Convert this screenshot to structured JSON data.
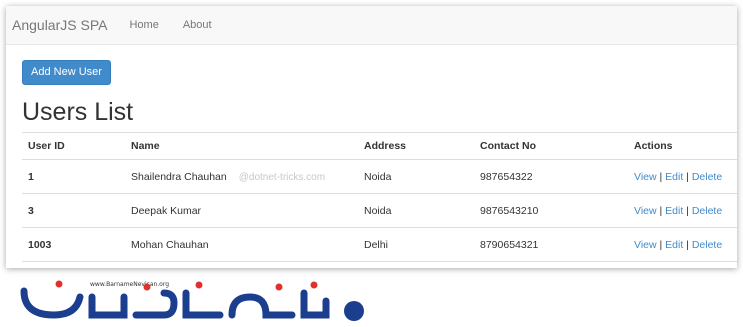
{
  "navbar": {
    "brand": "AngularJS SPA",
    "links": [
      "Home",
      "About"
    ]
  },
  "main": {
    "add_button": "Add New User",
    "title": "Users List"
  },
  "table": {
    "headers": [
      "User ID",
      "Name",
      "Address",
      "Contact No",
      "Actions"
    ],
    "rows": [
      {
        "id": "1",
        "name": "Shailendra Chauhan",
        "address": "Noida",
        "contact": "987654322"
      },
      {
        "id": "3",
        "name": "Deepak Kumar",
        "address": "Noida",
        "contact": "9876543210"
      },
      {
        "id": "1003",
        "name": "Mohan Chauhan",
        "address": "Delhi",
        "contact": "8790654321"
      }
    ],
    "actions": {
      "view": "View",
      "edit": "Edit",
      "delete": "Delete",
      "separator": "|"
    },
    "watermark": "@dotnet-tricks.com"
  },
  "logo": {
    "url_text": "www.BarnameNevisan.org",
    "colors": {
      "blue": "#1c3e8f",
      "red": "#e0312f"
    }
  },
  "colors": {
    "accent": "#428bca",
    "navbar_bg": "#f8f8f8"
  }
}
